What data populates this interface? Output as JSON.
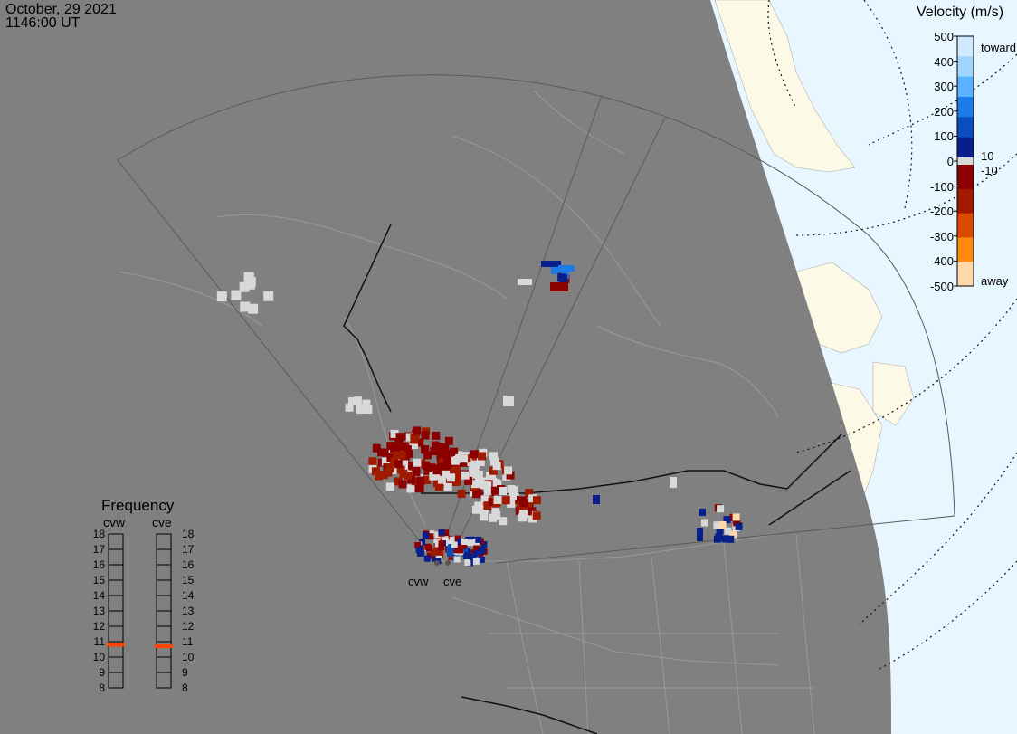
{
  "header": {
    "date": "October, 29 2021",
    "time": "1146:00 UT"
  },
  "colorbar": {
    "title": "Velocity (m/s)",
    "ticks": [
      "500",
      "400",
      "300",
      "200",
      "100",
      "0",
      "-100",
      "-200",
      "-300",
      "-400",
      "-500"
    ],
    "inner_labels": [
      "10",
      "-10"
    ],
    "toward_label": "toward",
    "away_label": "away",
    "colors": [
      "#cfeaff",
      "#9fd4ff",
      "#59b1ff",
      "#1d7be8",
      "#0b4dbd",
      "#061f8a",
      "#8b0000",
      "#a01a00",
      "#d94a00",
      "#ff8a10",
      "#ffd7a8"
    ],
    "ground_scatter_color": "#d8d8d8"
  },
  "frequency_panel": {
    "title": "Frequency",
    "radars": [
      {
        "name": "cvw",
        "frequency_mhz": 10.8
      },
      {
        "name": "cve",
        "frequency_mhz": 10.7
      }
    ],
    "ticks": [
      "18",
      "17",
      "16",
      "15",
      "14",
      "13",
      "12",
      "11",
      "10",
      "9",
      "8"
    ],
    "marker_color": "#ff4500"
  },
  "map": {
    "night_color": "#808080",
    "day_land_color": "#fcf9e6",
    "day_ocean_color": "#e8f6ff",
    "radar_sites": [
      "cvw",
      "cve"
    ]
  }
}
